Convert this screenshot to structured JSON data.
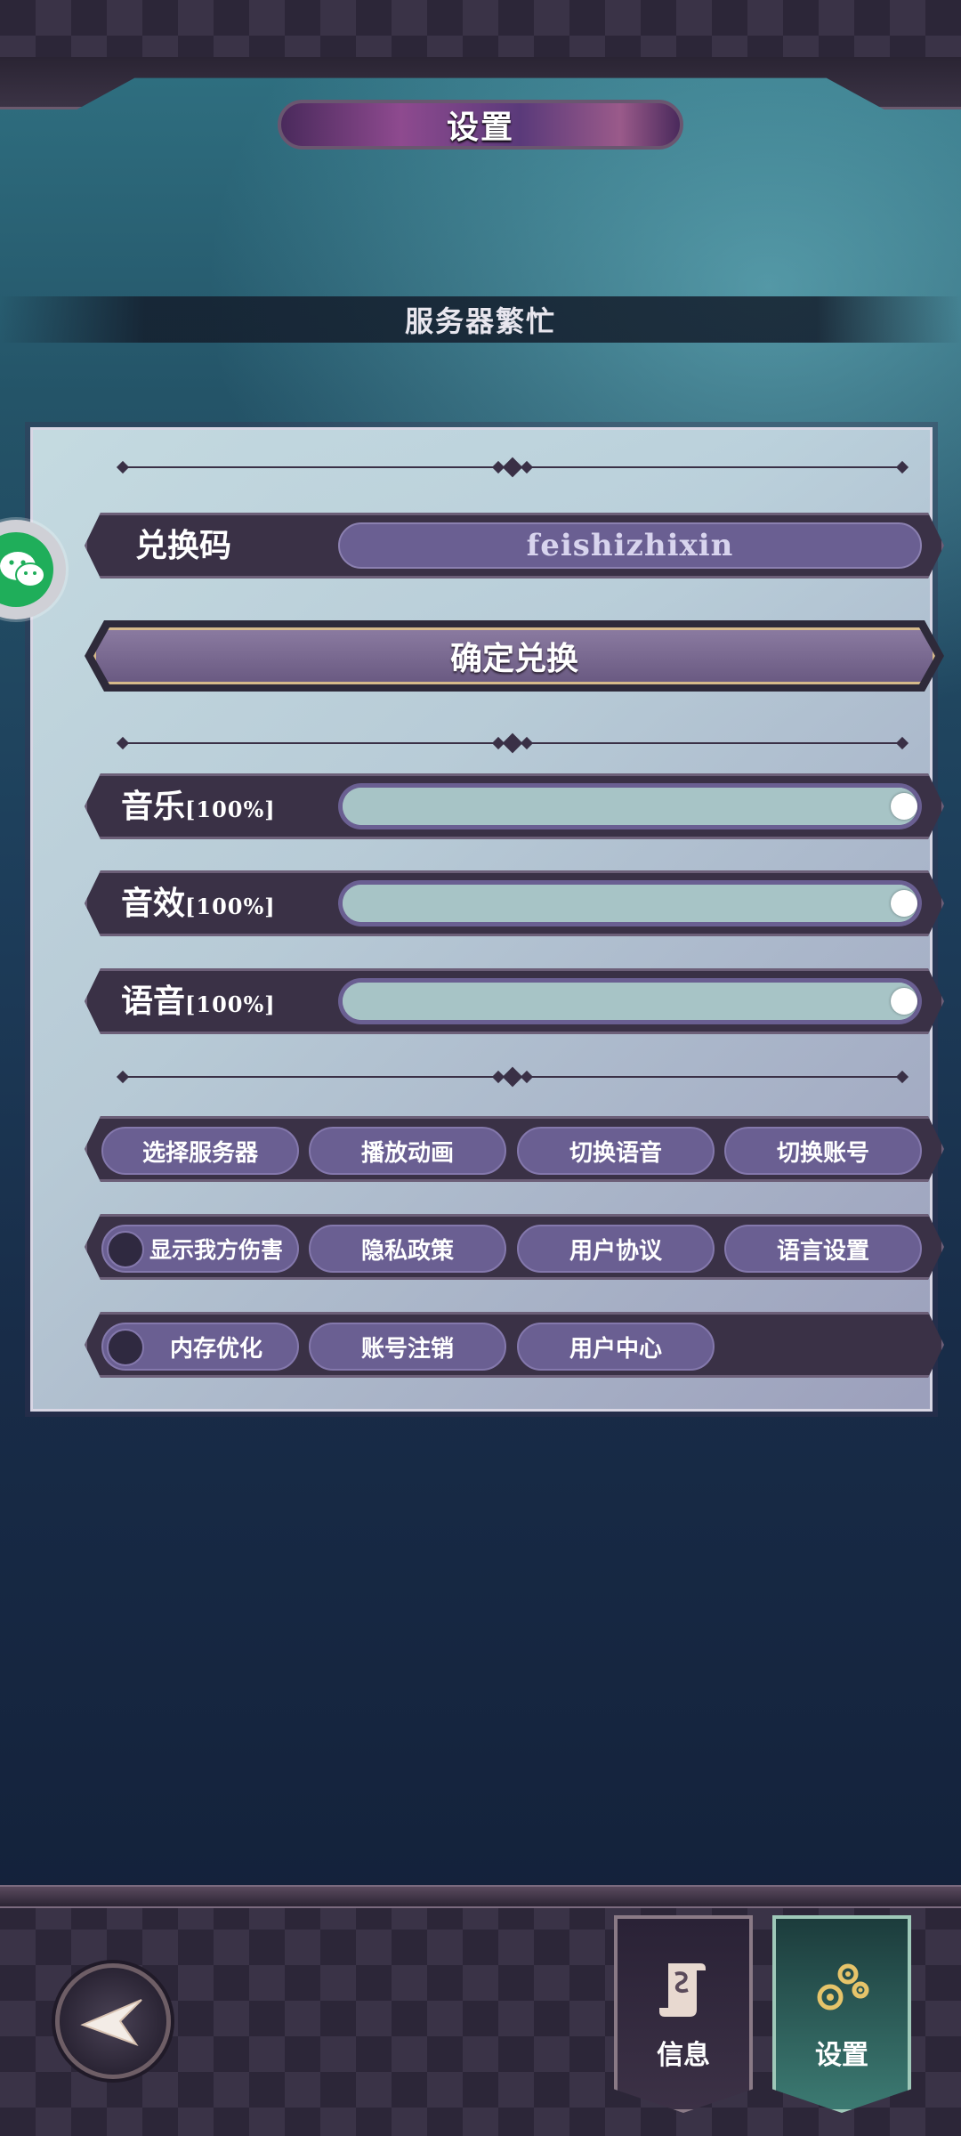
{
  "header": {
    "title": "设置"
  },
  "server_status": "服务器繁忙",
  "redeem": {
    "label": "兑换码",
    "code_value": "feishizhixin",
    "confirm_label": "确定兑换"
  },
  "audio": [
    {
      "label": "音乐",
      "percent_text": "[100%]",
      "level": 1.0
    },
    {
      "label": "音效",
      "percent_text": "[100%]",
      "level": 1.0
    },
    {
      "label": "语音",
      "percent_text": "[100%]",
      "level": 1.0
    }
  ],
  "buttons_row1": [
    "选择服务器",
    "播放动画",
    "切换语音",
    "切换账号"
  ],
  "buttons_row2": {
    "toggle_label": "显示我方伤害",
    "toggle_on": false,
    "items": [
      "隐私政策",
      "用户协议",
      "语言设置"
    ]
  },
  "buttons_row3": {
    "toggle_label": "内存优化",
    "toggle_on": false,
    "items": [
      "账号注销",
      "用户中心"
    ]
  },
  "bottom_nav": {
    "tabs": [
      {
        "label": "信息",
        "icon": "scroll-icon",
        "active": false
      },
      {
        "label": "设置",
        "icon": "gears-icon",
        "active": true
      }
    ],
    "back_icon": "back-arrow-icon"
  },
  "floating": {
    "icon": "wechat-icon",
    "color": "#1fae5a"
  }
}
